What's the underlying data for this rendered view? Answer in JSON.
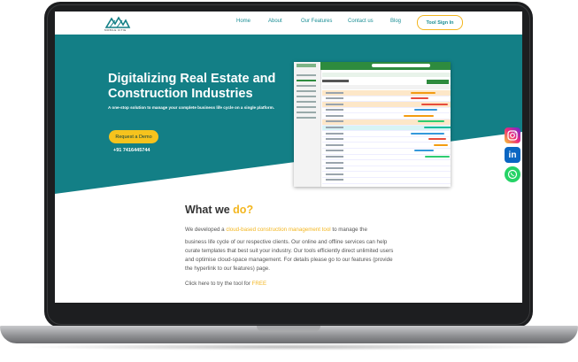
{
  "nav": {
    "logo_text": "MOBILE CITIE",
    "links": [
      "Home",
      "About",
      "Our Features",
      "Contact us",
      "Blog"
    ],
    "signin_label": "Tool Sign In"
  },
  "hero": {
    "title": "Digitalizing Real Estate and Construction Industries",
    "subtitle": "A one-stop solution to manage your complete business life cycle on a single platform.",
    "cta_label": "Request a Demo",
    "phone": "+91 7416445744"
  },
  "colors": {
    "teal": "#137f86",
    "accent": "#f6c31d"
  },
  "social_icons": [
    "instagram-icon",
    "linkedin-icon",
    "whatsapp-icon"
  ],
  "about": {
    "heading_main": "What we ",
    "heading_accent": "do?",
    "intro_prefix": "We developed a ",
    "intro_link": "cloud-based construction management tool",
    "intro_suffix": " to manage the",
    "body": "business life cycle of our respective clients. Our online and offline services can help curate templates that best suit your industry. Our tools efficiently direct unlimited users and optimise cloud-space management. For details please go to our features (provide the hyperlink to our features) page.",
    "cta_prefix": "Click here to try the tool for ",
    "cta_link": "FREE"
  }
}
